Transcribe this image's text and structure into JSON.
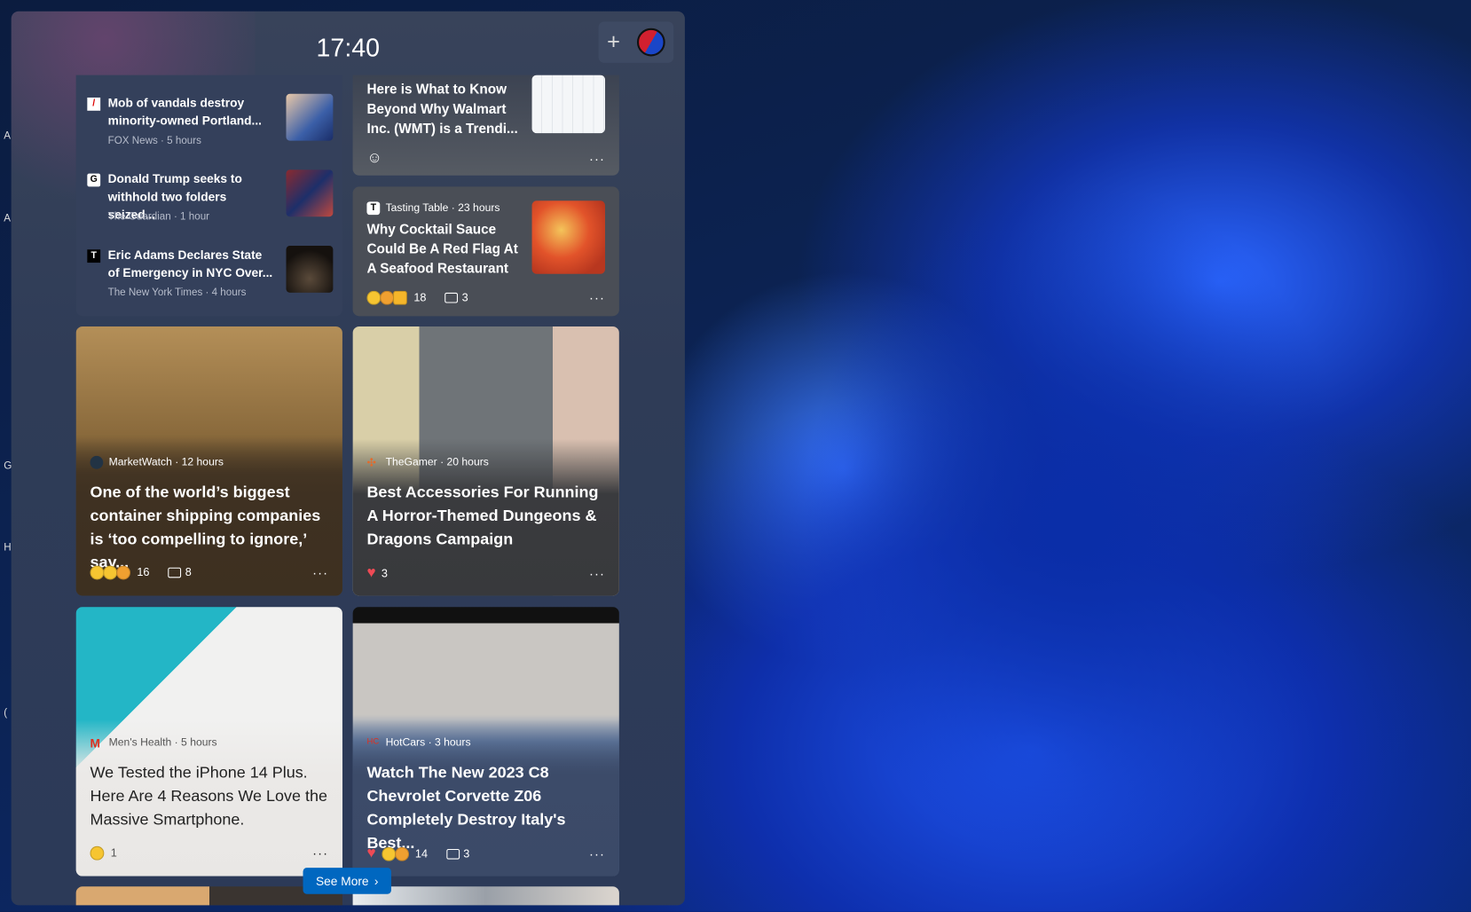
{
  "edge_letters": [
    "A",
    "A",
    "G",
    "H",
    "("
  ],
  "widgets": {
    "clock": "17:40",
    "add_label": "+",
    "avatar_icon": "user-avatar"
  },
  "top_stories": [
    {
      "title": "Mob of vandals destroy minority-owned Portland...",
      "meta": "FOX News · 5 hours",
      "logo": "/"
    },
    {
      "title": "Donald Trump seeks to withhold two folders seized...",
      "meta": "The Guardian · 1 hour",
      "logo": "G"
    },
    {
      "title": "Eric Adams Declares State of Emergency in NYC Over...",
      "meta": "The New York Times · 4 hours",
      "logo": "T"
    }
  ],
  "cards": [
    {
      "title": "Here is What to Know Beyond Why Walmart Inc. (WMT) is a Trendi...",
      "react_icon": "add-reaction"
    },
    {
      "source": "Tasting Table · 23 hours",
      "logo": "T",
      "title": "Why Cocktail Sauce Could Be A Red Flag At A Seafood Restaurant",
      "reactions": "18",
      "comments": "3"
    },
    {
      "source": "MarketWatch · 12 hours",
      "title": "One of the world’s biggest container shipping companies is ‘too compelling to ignore,’ say...",
      "reactions": "16",
      "comments": "8"
    },
    {
      "source": "TheGamer · 20 hours",
      "title": "Best Accessories For Running A Horror-Themed Dungeons & Dragons Campaign",
      "reactions": "3"
    },
    {
      "source": "Men's Health · 5 hours",
      "logo": "M",
      "title": "We Tested the iPhone 14 Plus. Here Are 4 Reasons We Love the Massive Smartphone.",
      "reactions": "1"
    },
    {
      "source": "HotCars · 3 hours",
      "title": "Watch The New 2023 C8 Chevrolet Corvette Z06 Completely Destroy Italy's Best...",
      "reactions": "14",
      "comments": "3"
    }
  ],
  "more": "···",
  "see_more": "See More",
  "colors": {
    "accent": "#0067c0",
    "panel": "#2f3c57"
  }
}
